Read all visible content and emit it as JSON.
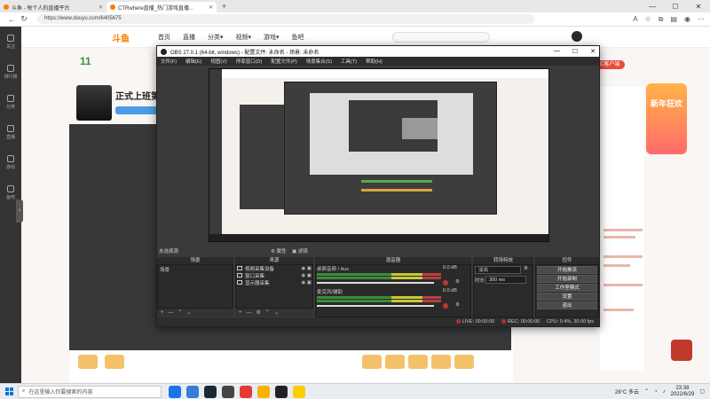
{
  "browser": {
    "tabs": [
      {
        "label": "斗鱼 - 每个人的直播平台"
      },
      {
        "label": "CTRwhere直播_热门游戏直播..."
      },
      {
        "label": "+"
      }
    ],
    "url": "https://www.douyu.com/6405675",
    "window_controls": [
      "—",
      "☐",
      "✕"
    ]
  },
  "site": {
    "logo": "斗鱼",
    "nav": [
      "首页",
      "直播",
      "分类▾",
      "视频▾",
      "游戏▾",
      "鱼吧"
    ],
    "room": {
      "level": "11",
      "title": "正式上班第一"
    },
    "pc_button": "PC客户端",
    "promo": "新年狂欢",
    "sidebar": [
      "关注",
      "排行榜",
      "分类",
      "直播",
      "游戏",
      "鱼吧"
    ]
  },
  "obs": {
    "title": "OBS 27.0.1 (64-bit, windows) - 配置文件: 未命名 - 场景: 未命名",
    "menu": [
      "文件(F)",
      "编辑(E)",
      "视图(V)",
      "停靠窗口(D)",
      "配置文件(P)",
      "场景集合(S)",
      "工具(T)",
      "帮助(H)"
    ],
    "no_source": "未选择源",
    "props_button": "⚙ 属性",
    "filters_button": "▣ 滤镜",
    "docks": {
      "scenes": "场景",
      "sources": "来源",
      "mixer": "混音器",
      "transitions": "转场特效",
      "controls": "控件"
    },
    "scene_item": "场景",
    "sources": [
      "视频采集设备",
      "窗口采集",
      "显示器采集"
    ],
    "mixer": [
      {
        "name": "桌面音频 / Aux",
        "db": "0.0 dB"
      },
      {
        "name": "麦克风/辅助",
        "db": "0.0 dB"
      }
    ],
    "transition": {
      "type": "淡出",
      "duration_label": "时长",
      "duration": "300 ms"
    },
    "controls": [
      "开始推流",
      "开始录制",
      "工作室模式",
      "设置",
      "退出"
    ],
    "status": {
      "live": "LIVE: 00:00:00",
      "rec": "REC: 00:00:00",
      "cpu": "CPU: 0.4%, 30.00 fps"
    }
  },
  "taskbar": {
    "search_placeholder": "在这里输入你要搜索的内容",
    "weather": "28°C 多云",
    "time": "23:38",
    "date": "2022/6/29"
  }
}
